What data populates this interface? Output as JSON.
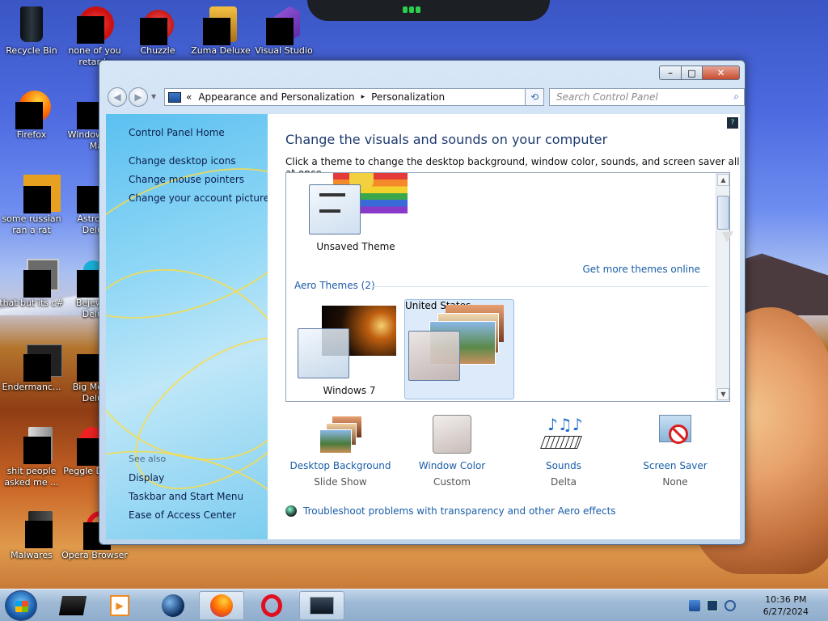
{
  "desktop": {
    "icons": [
      {
        "label": "Recycle Bin"
      },
      {
        "label": "none of you retards"
      },
      {
        "label": "Chuzzle"
      },
      {
        "label": "Zuma Deluxe"
      },
      {
        "label": "Visual Studio"
      },
      {
        "label": "Firefox"
      },
      {
        "label": "Window Ma"
      },
      {
        "label": "some russian ran a rat"
      },
      {
        "label": "Astrol Delu"
      },
      {
        "label": "that but its c#"
      },
      {
        "label": "Bejew Delu"
      },
      {
        "label": "Endermanc..."
      },
      {
        "label": "Big Mo Delu"
      },
      {
        "label": "shit people asked me ..."
      },
      {
        "label": "Peggle D"
      },
      {
        "label": "Malwares"
      },
      {
        "label": "Opera Browser"
      }
    ]
  },
  "window": {
    "title_buttons": {
      "minimize": "–",
      "maximize": "□",
      "close": "✕"
    },
    "address": {
      "chevron": "«",
      "crumbs": [
        "Appearance and Personalization",
        "Personalization"
      ],
      "separator": "▸"
    },
    "search": {
      "placeholder": "Search Control Panel"
    },
    "sidebar": {
      "home": "Control Panel Home",
      "links": [
        "Change desktop icons",
        "Change mouse pointers",
        "Change your account picture"
      ],
      "see_also_heading": "See also",
      "see_also_links": [
        "Display",
        "Taskbar and Start Menu",
        "Ease of Access Center"
      ]
    },
    "main": {
      "title": "Change the visuals and sounds on your computer",
      "description": "Click a theme to change the desktop background, window color, sounds, and screen saver all at once.",
      "my_themes": [
        {
          "label": "Unsaved Theme"
        }
      ],
      "get_more_link": "Get more themes online",
      "aero_heading": "Aero Themes (2)",
      "aero_themes": [
        {
          "label": "Windows 7"
        },
        {
          "label": "United States",
          "selected": true
        }
      ],
      "options": [
        {
          "name": "Desktop Background",
          "value": "Slide Show",
          "icon": "desktop-background-icon"
        },
        {
          "name": "Window Color",
          "value": "Custom",
          "icon": "window-color-icon"
        },
        {
          "name": "Sounds",
          "value": "Delta",
          "icon": "sounds-icon"
        },
        {
          "name": "Screen Saver",
          "value": "None",
          "icon": "screen-saver-icon"
        }
      ],
      "troubleshoot_link": "Troubleshoot problems with transparency and other Aero effects"
    }
  },
  "taskbar": {
    "items": [
      "task-manager-icon",
      "media-player-icon",
      "globe-app-icon",
      "firefox-icon",
      "opera-icon",
      "control-panel-icon"
    ],
    "clock": {
      "time": "10:36 PM",
      "date": "6/27/2024"
    }
  },
  "colors": {
    "link": "#1a5ea8",
    "accent": "#1e3a6e"
  }
}
